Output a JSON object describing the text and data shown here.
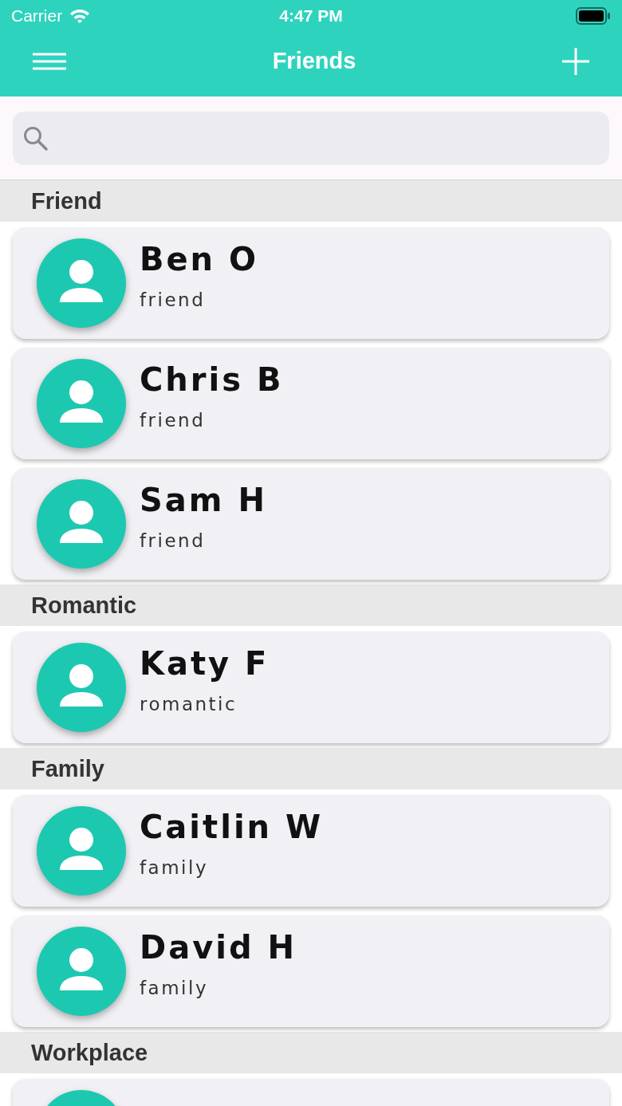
{
  "status_bar": {
    "carrier": "Carrier",
    "time": "4:47 PM"
  },
  "nav_bar": {
    "title": "Friends"
  },
  "sections": [
    {
      "title": "Friend",
      "contacts": [
        {
          "name": "Ben O",
          "group": "friend"
        },
        {
          "name": "Chris B",
          "group": "friend"
        },
        {
          "name": "Sam H",
          "group": "friend"
        }
      ]
    },
    {
      "title": "Romantic",
      "contacts": [
        {
          "name": "Katy F",
          "group": "romantic"
        }
      ]
    },
    {
      "title": "Family",
      "contacts": [
        {
          "name": "Caitlin W",
          "group": "family"
        },
        {
          "name": "David H",
          "group": "family"
        }
      ]
    },
    {
      "title": "Workplace",
      "cut_card_below": true
    }
  ]
}
